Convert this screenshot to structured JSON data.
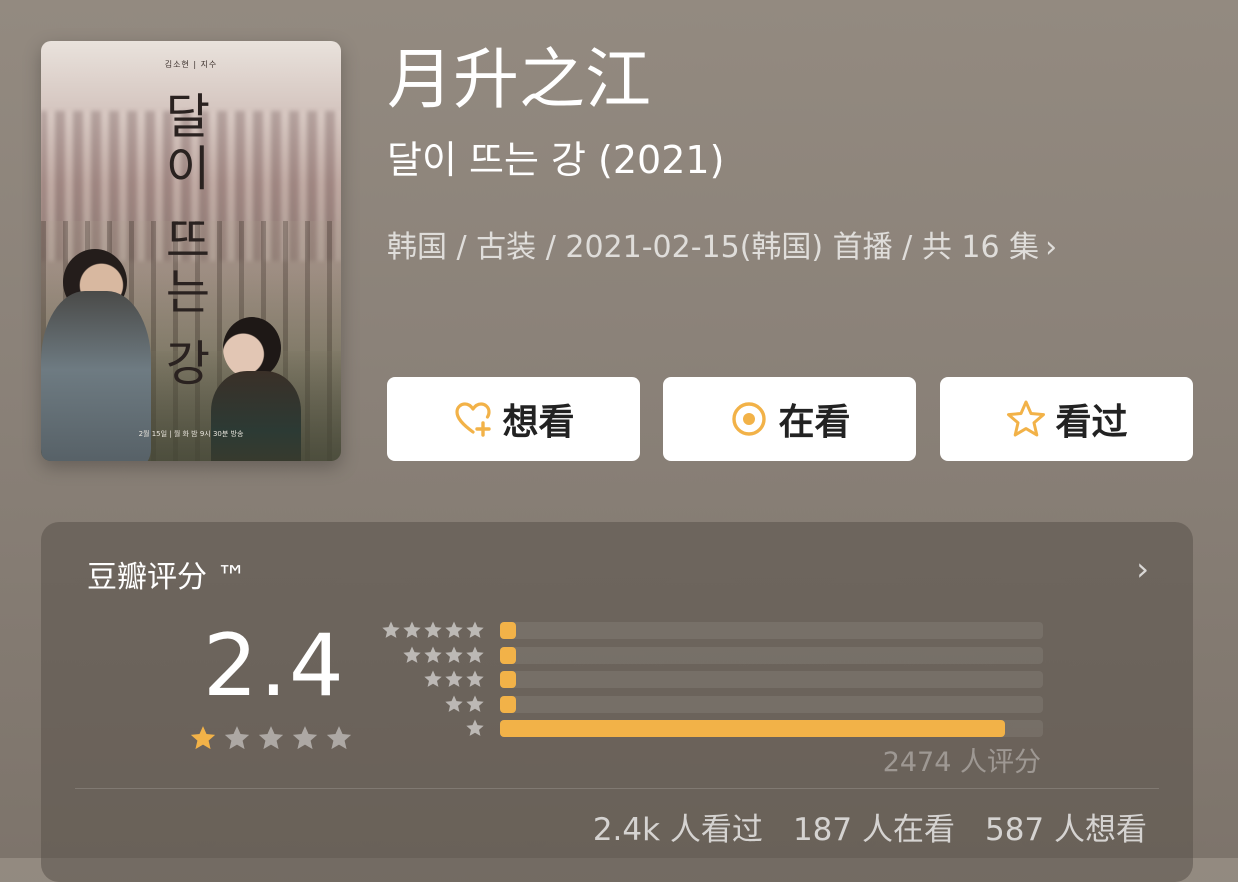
{
  "poster": {
    "top_credit": "김소현 | 지수",
    "korean_title": "달이 뜨는 강",
    "bottom_credit": "2월 15일 | 월 화 밤 9시 30분 방송"
  },
  "title": "月升之江",
  "original_title": "달이 뜨는 강 (2021)",
  "meta": "韩国 / 古装 / 2021-02-15(韩国) 首播 / 共 16 集",
  "actions": {
    "want": {
      "label": "想看",
      "icon": "heart-plus-icon"
    },
    "watching": {
      "label": "在看",
      "icon": "target-circle-icon"
    },
    "watched": {
      "label": "看过",
      "icon": "star-outline-icon"
    }
  },
  "colors": {
    "accent": "#f2b248",
    "button_bg": "#ffffff"
  },
  "rating": {
    "label": "豆瓣评分 ™",
    "score": "2.4",
    "stars_filled": 1,
    "stars_total": 5,
    "distribution": [
      {
        "stars": 5,
        "fraction": 0.03
      },
      {
        "stars": 4,
        "fraction": 0.03
      },
      {
        "stars": 3,
        "fraction": 0.03
      },
      {
        "stars": 2,
        "fraction": 0.03
      },
      {
        "stars": 1,
        "fraction": 0.93
      }
    ],
    "total": "2474 人评分"
  },
  "stats": {
    "watched": "2.4k 人看过",
    "watching": "187 人在看",
    "want": "587 人想看"
  }
}
